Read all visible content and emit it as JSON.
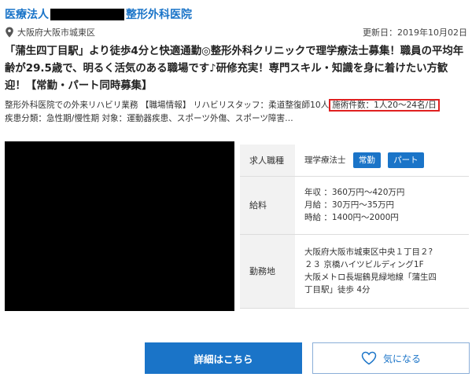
{
  "header": {
    "title_prefix": "医療法人",
    "title_suffix": "整形外科医院",
    "location": "大阪府大阪市城東区",
    "updated": "更新日：2019年10月02日"
  },
  "headline": "「蒲生四丁目駅」より徒歩4分と快適通勤◎整形外科クリニックで理学療法士募集！職員の平均年齢が29.5歳で、明るく活気のある職場です♪研修充実！専門スキル・知識を身に着けたい方歓迎！【常勤・パート同時募集】",
  "description": {
    "line1_text": "整形外科医院での外来リハビリ業務 【職場情報】 リハビリスタッフ：柔道整復師10人",
    "line1_highlight": "施術件数：1人20〜24名/日",
    "line2_text": "疾患分類：急性期/慢性期 対象：運動器疾患、スポーツ外傷、スポーツ障害…"
  },
  "info": {
    "job_type_label": "求人職種",
    "job_type_value": "理学療法士",
    "tags": [
      "常勤",
      "パート"
    ],
    "salary_label": "給料",
    "salary_lines": [
      "年収 ：360万円〜420万円",
      "月給 ：30万円〜35万円",
      "時給 ：1400円〜2000円"
    ],
    "place_label": "勤務地",
    "place_lines": [
      "大阪府大阪市城東区中央１丁目２?",
      "２３ 京橋ハイツビルディング1F",
      "大阪メトロ長堀鶴見緑地線「蒲生四",
      "丁目駅」徒歩 4分"
    ]
  },
  "buttons": {
    "detail": "詳細はこちら",
    "favorite": "気になる"
  },
  "colors": {
    "accent": "#1a74c8",
    "highlight_border": "#e02020"
  }
}
